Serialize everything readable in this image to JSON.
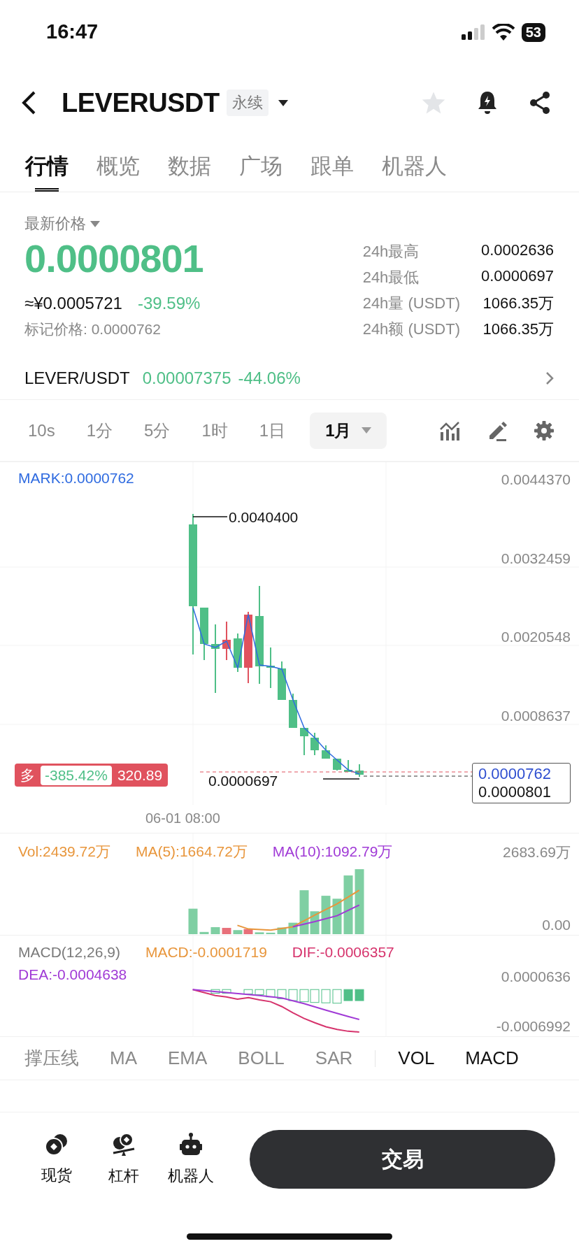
{
  "status_bar": {
    "time": "16:47",
    "battery": "53"
  },
  "header": {
    "title": "LEVERUSDT",
    "tag": "永续",
    "favorite": false
  },
  "tabs": [
    {
      "label": "行情",
      "selected": true
    },
    {
      "label": "概览",
      "selected": false
    },
    {
      "label": "数据",
      "selected": false
    },
    {
      "label": "广场",
      "selected": false
    },
    {
      "label": "跟单",
      "selected": false
    },
    {
      "label": "机器人",
      "selected": false
    }
  ],
  "price": {
    "label": "最新价格",
    "last": "0.0000801",
    "cny": "≈¥0.0005721",
    "change": "-39.59%",
    "mark": "标记价格: 0.0000762"
  },
  "stats": [
    {
      "label": "24h最高",
      "value": "0.0002636"
    },
    {
      "label": "24h最低",
      "value": "0.0000697"
    },
    {
      "label": "24h量 (USDT)",
      "value": "1066.35万"
    },
    {
      "label": "24h额 (USDT)",
      "value": "1066.35万"
    }
  ],
  "spot": {
    "pair": "LEVER/USDT",
    "price": "0.00007375",
    "change": "-44.06%"
  },
  "intervals": [
    {
      "label": "10s",
      "selected": false,
      "kind": "plain"
    },
    {
      "label": "1分",
      "selected": false,
      "kind": "plain"
    },
    {
      "label": "5分",
      "selected": false,
      "kind": "plain"
    },
    {
      "label": "1时",
      "selected": false,
      "kind": "plain"
    },
    {
      "label": "1日",
      "selected": false,
      "kind": "plain"
    },
    {
      "label": "1月",
      "selected": true,
      "kind": "dropdown"
    }
  ],
  "chart": {
    "mark_label": "MARK:0.0000762",
    "y_ticks": [
      "0.0044370",
      "0.0032459",
      "0.0020548",
      "0.0008637"
    ],
    "high_label": "0.0040400",
    "low_label": "0.0000697",
    "position": {
      "side": "多",
      "pnl": "-385.42%",
      "value": "320.89"
    },
    "price_tags": [
      {
        "text": "0.0000762",
        "kind": "mark"
      },
      {
        "text": "0.0000801",
        "kind": "last"
      }
    ],
    "date": "06-01 08:00"
  },
  "volume": {
    "legend": [
      {
        "text": "Vol:2439.72万",
        "color": "#e8963c"
      },
      {
        "text": "MA(5):1664.72万",
        "color": "#e8963c"
      },
      {
        "text": "MA(10):1092.79万",
        "color": "#a03ad6"
      }
    ],
    "y_ticks": [
      "2683.69万",
      "0.00"
    ]
  },
  "macd": {
    "legend": [
      {
        "text": "MACD(12,26,9)",
        "color": "#7a7a7a"
      },
      {
        "text": "MACD:-0.0001719",
        "color": "#e8963c"
      },
      {
        "text": "DIF:-0.0006357",
        "color": "#d6336c"
      },
      {
        "text": "DEA:-0.0004638",
        "color": "#a03ad6"
      }
    ],
    "y_ticks": [
      "0.0000636",
      "-0.0006992"
    ]
  },
  "indicators": [
    {
      "label": "撑压线",
      "selected": false
    },
    {
      "label": "MA",
      "selected": false
    },
    {
      "label": "EMA",
      "selected": false
    },
    {
      "label": "BOLL",
      "selected": false
    },
    {
      "label": "SAR",
      "selected": false
    },
    {
      "label": "VOL",
      "selected": true
    },
    {
      "label": "MACD",
      "selected": true
    }
  ],
  "bottom_nav": [
    {
      "label": "现货",
      "kind": "spot"
    },
    {
      "label": "杠杆",
      "kind": "margin"
    },
    {
      "label": "机器人",
      "kind": "bot"
    }
  ],
  "trade_button": "交易"
}
